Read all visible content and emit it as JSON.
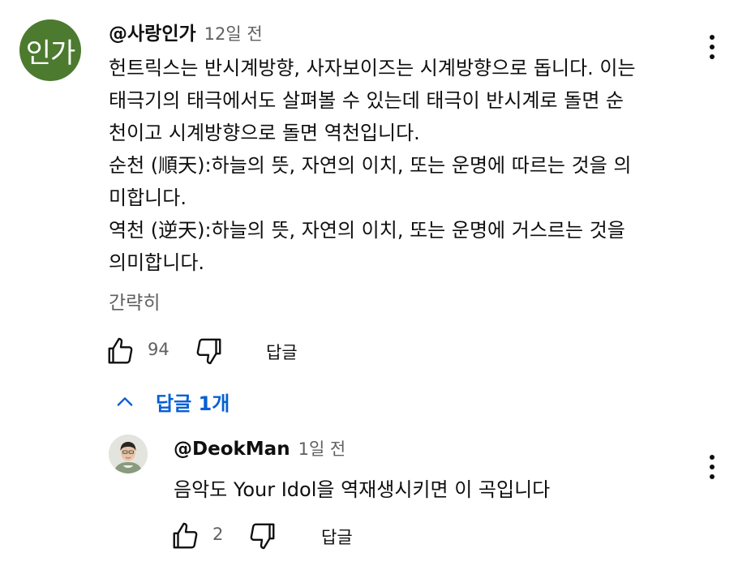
{
  "comment": {
    "avatar_text": "인가",
    "author": "@사랑인가",
    "time": "12일 전",
    "lines": [
      "헌트릭스는 반시계방향, 사자보이즈는 시계방향으로 돕니다. 이는",
      "태극기의 태극에서도 살펴볼 수 있는데 태극이 반시계로 돌면 순",
      "천이고 시계방향으로 돌면 역천입니다.",
      "순천 (順天):하늘의 뜻, 자연의 이치, 또는 운명에 따르는 것을 의",
      "미합니다.",
      "역천 (逆天):하늘의 뜻, 자연의 이치, 또는 운명에 거스르는 것을",
      "의미합니다."
    ],
    "collapse_label": "간략히",
    "like_count": "94",
    "reply_label": "답글"
  },
  "replies_toggle": {
    "label": "답글 1개"
  },
  "reply": {
    "author": "@DeokMan",
    "time": "1일 전",
    "text": "음악도 Your Idol을 역재생시키면 이 곡입니다",
    "like_count": "2",
    "reply_label": "답글"
  },
  "colors": {
    "avatar_bg": "#4c7a2f",
    "link_blue": "#065fd4",
    "secondary_text": "#606060"
  },
  "icons": [
    "thumbs-up-icon",
    "thumbs-down-icon",
    "more-vert-icon",
    "chevron-up-icon"
  ]
}
